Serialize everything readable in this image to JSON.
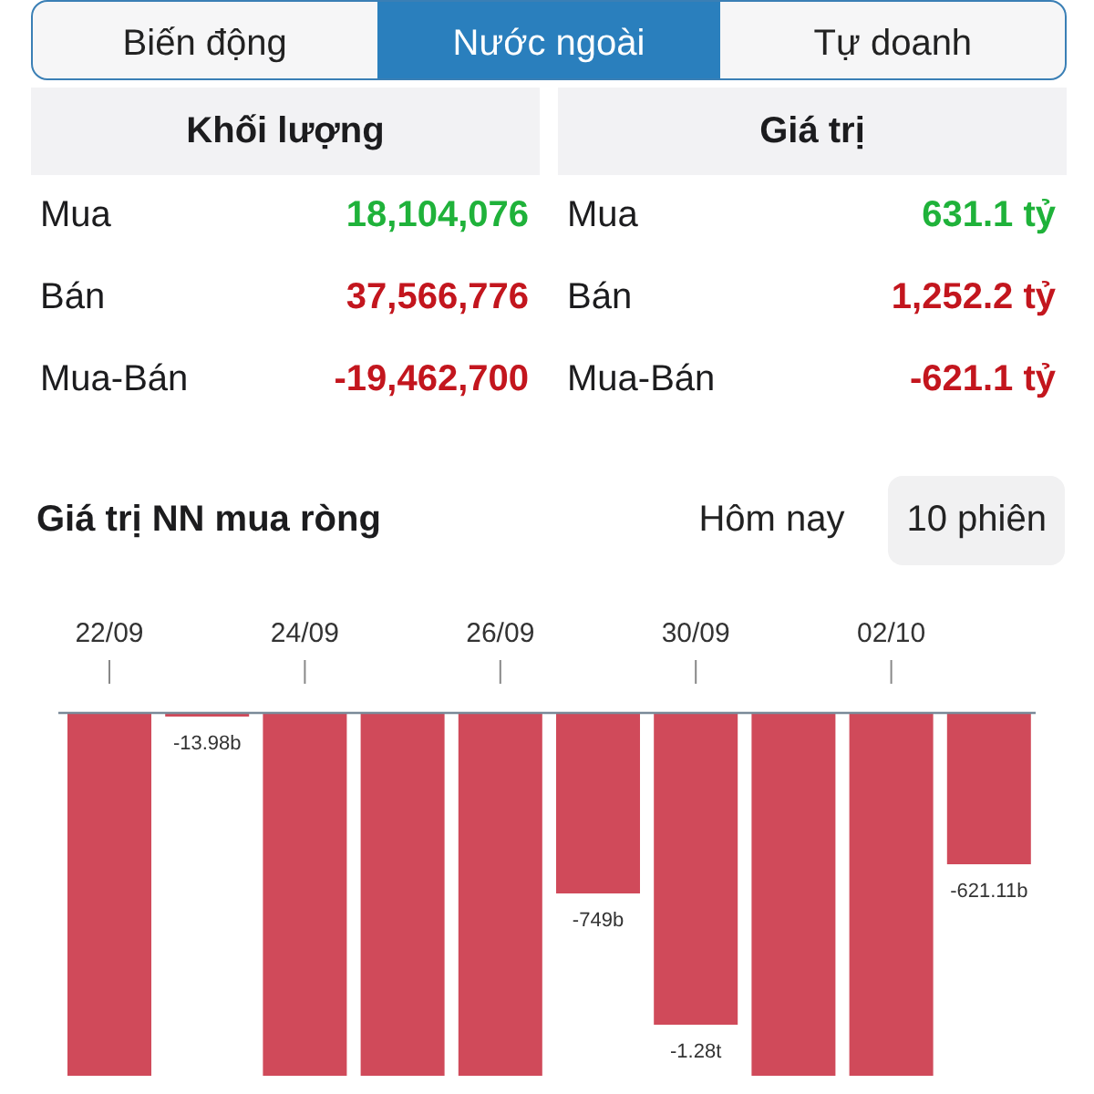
{
  "tabs": [
    {
      "label": "Biến động",
      "selected": false
    },
    {
      "label": "Nước ngoài",
      "selected": true
    },
    {
      "label": "Tự doanh",
      "selected": false
    }
  ],
  "cards": [
    {
      "title": "Khối lượng",
      "rows": [
        {
          "label": "Mua",
          "value": "18,104,076",
          "color": "#1fb23a"
        },
        {
          "label": "Bán",
          "value": "37,566,776",
          "color": "#c3161e"
        },
        {
          "label": "Mua-Bán",
          "value": "-19,462,700",
          "color": "#c3161e"
        }
      ]
    },
    {
      "title": "Giá trị",
      "rows": [
        {
          "label": "Mua",
          "value": "631.1 tỷ",
          "color": "#1fb23a"
        },
        {
          "label": "Bán",
          "value": "1,252.2 tỷ",
          "color": "#c3161e"
        },
        {
          "label": "Mua-Bán",
          "value": "-621.1 tỷ",
          "color": "#c3161e"
        }
      ]
    }
  ],
  "section": {
    "title": "Giá trị NN mua ròng",
    "periods": [
      {
        "label": "Hôm nay",
        "selected": false
      },
      {
        "label": "10 phiên",
        "selected": true
      }
    ]
  },
  "chart": {
    "bars": [
      {
        "kind": "bar",
        "date": "22/09"
      },
      {
        "kind": "bar",
        "label": "-13.98b"
      },
      {
        "kind": "bar",
        "date": "24/09"
      },
      {
        "kind": "bar"
      },
      {
        "kind": "bar",
        "date": "26/09"
      },
      {
        "kind": "bar",
        "label": "-749b"
      },
      {
        "kind": "bar",
        "date": "30/09",
        "label": "-1.28t"
      },
      {
        "kind": "bar"
      },
      {
        "kind": "bar",
        "date": "02/10"
      },
      {
        "kind": "bar",
        "label": "-621.11b"
      }
    ]
  }
}
